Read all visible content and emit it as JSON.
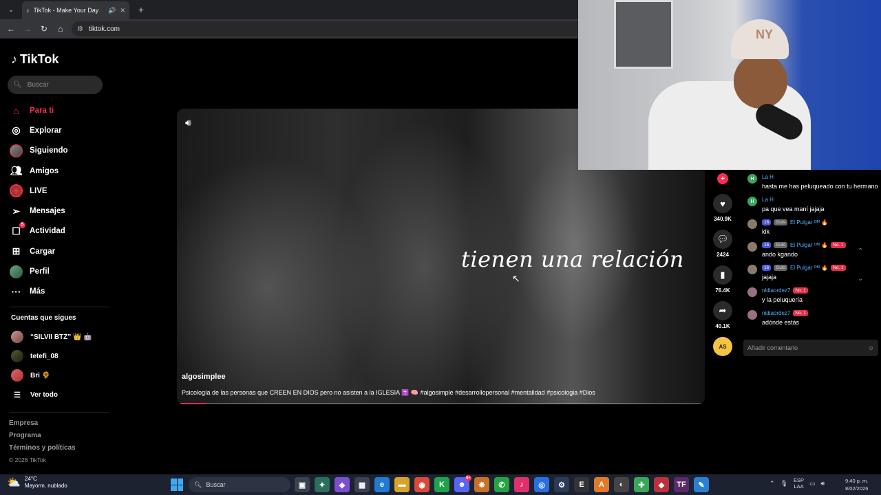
{
  "browser": {
    "tab_title": "TikTok - Make Your Day",
    "tab_favicon": "♪",
    "url": "tiktok.com"
  },
  "sidebar": {
    "brand": "TikTok",
    "search_placeholder": "Buscar",
    "menu": [
      {
        "label": "Para ti",
        "icon": "home-icon",
        "active": true
      },
      {
        "label": "Explorar",
        "icon": "compass-icon"
      },
      {
        "label": "Siguiendo",
        "icon": "following-avatar-icon"
      },
      {
        "label": "Amigos",
        "icon": "friends-icon"
      },
      {
        "label": "LIVE",
        "icon": "live-icon"
      },
      {
        "label": "Mensajes",
        "icon": "messages-icon"
      },
      {
        "label": "Actividad",
        "icon": "activity-icon",
        "badge": "5"
      },
      {
        "label": "Cargar",
        "icon": "upload-icon"
      },
      {
        "label": "Perfil",
        "icon": "profile-icon"
      },
      {
        "label": "Más",
        "icon": "more-icon"
      }
    ],
    "following_heading": "Cuentas que sigues",
    "following": [
      {
        "name": "“SILVII BTZ” 👑 🤖"
      },
      {
        "name": "tetefi_08"
      },
      {
        "name": "Bri 🌻"
      },
      {
        "name": "Ver todo"
      }
    ],
    "footer": [
      "Empresa",
      "Programa",
      "Términos y políticas"
    ],
    "copyright": "© 2026 TikTok"
  },
  "video": {
    "overlay_text": "tienen una relación",
    "author": "algosimplee",
    "description": "Psicología de las personas que CREEN EN DIOS pero no asisten a la IGLESIA ✝️ 🧠 #algosimple #desarrollopersonal #mentalidad #psicologia #Dios",
    "progress": 0.05,
    "likes": "340.9K",
    "comments": "2424",
    "saves": "76.4K",
    "shares": "40.1K",
    "music_disc": "AS"
  },
  "chat": {
    "messages": [
      {
        "user": "La H",
        "avatar": "H",
        "avatar_color": "#3aa65a",
        "text": "hasta me has peluqueado con tu hermano",
        "badges": []
      },
      {
        "user": "La H",
        "avatar": "H",
        "avatar_color": "#3aa65a",
        "text": "pa que vea maní jajaja",
        "badges": []
      },
      {
        "user": "El Pulgar ᴼᴹ 🔥",
        "avatar": "",
        "avatar_color": "#8a7a6a",
        "text": "klk",
        "badges": [
          "16",
          "Guts"
        ]
      },
      {
        "user": "El Pulgar ᴼᴹ 🔥",
        "avatar": "",
        "avatar_color": "#8a7a6a",
        "text": "ando kgando",
        "badges": [
          "16",
          "Guts",
          "No. 1"
        ]
      },
      {
        "user": "El Pulgar ᴼᴹ 🔥",
        "avatar": "",
        "avatar_color": "#8a7a6a",
        "text": "jajaja",
        "badges": [
          "16",
          "Guts",
          "No. 1"
        ]
      },
      {
        "user": "nidiaordez7",
        "avatar": "",
        "avatar_color": "#9a7080",
        "text": "y la peluquería",
        "badges": [
          "No. 1"
        ]
      },
      {
        "user": "nidiaordez7",
        "avatar": "",
        "avatar_color": "#9a7080",
        "text": "adónde estás",
        "badges": [
          "No. 1"
        ]
      }
    ],
    "input_placeholder": "Añadir comentario"
  },
  "webcam": {
    "cap_logo": "NY"
  },
  "taskbar": {
    "temp": "24°C",
    "weather": "Mayorm. nublado",
    "search_placeholder": "Buscar",
    "lang_top": "ESP",
    "lang_bottom": "LAA",
    "time": "9:40 p. m.",
    "date": "8/02/2026",
    "discord_badge": "9+"
  }
}
